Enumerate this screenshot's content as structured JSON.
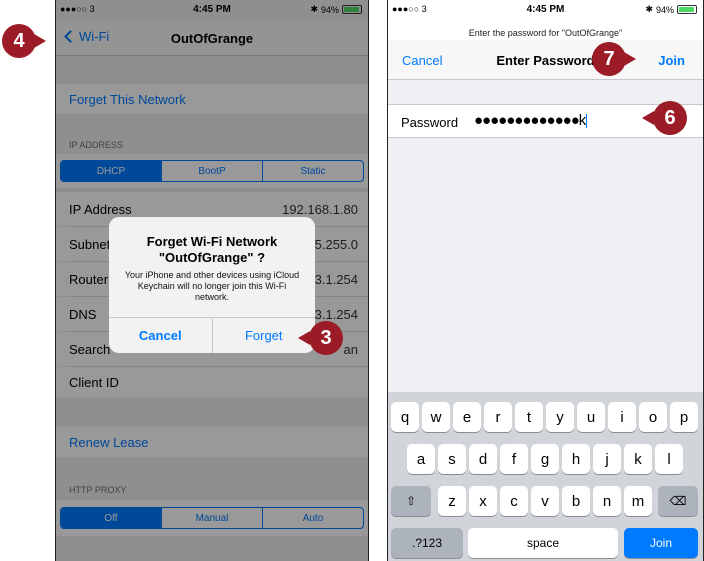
{
  "left": {
    "status": {
      "carrier": "●●●○○ 3",
      "time": "4:45 PM",
      "battery": "94%"
    },
    "nav": {
      "back_label": "Wi-Fi",
      "title": "OutOfGrange"
    },
    "forget_network": "Forget This Network",
    "ip_header": "IP ADDRESS",
    "ip_modes": [
      "DHCP",
      "BootP",
      "Static"
    ],
    "rows": [
      {
        "label": "IP Address",
        "value": "192.168.1.80"
      },
      {
        "label": "Subnet",
        "value": "5.255.0"
      },
      {
        "label": "Router",
        "value": "3.1.254"
      },
      {
        "label": "DNS",
        "value": "3.1.254"
      },
      {
        "label": "Search",
        "value": "an"
      },
      {
        "label": "Client ID",
        "value": ""
      }
    ],
    "renew_lease": "Renew Lease",
    "proxy_header": "HTTP PROXY",
    "proxy_modes": [
      "Off",
      "Manual",
      "Auto"
    ],
    "alert": {
      "title": "Forget Wi-Fi Network \"OutOfGrange\" ?",
      "message": "Your iPhone and other devices using iCloud Keychain will no longer join this Wi-Fi network.",
      "cancel": "Cancel",
      "forget": "Forget"
    }
  },
  "right": {
    "status": {
      "carrier": "●●●○○ 3",
      "time": "4:45 PM",
      "battery": "94%"
    },
    "prompt": "Enter the password for \"OutOfGrange\"",
    "nav": {
      "cancel": "Cancel",
      "title": "Enter Password",
      "join": "Join"
    },
    "password_label": "Password",
    "password_value": "●●●●●●●●●●●●●k",
    "keyboard": {
      "row1": [
        "q",
        "w",
        "e",
        "r",
        "t",
        "y",
        "u",
        "i",
        "o",
        "p"
      ],
      "row2": [
        "a",
        "s",
        "d",
        "f",
        "g",
        "h",
        "j",
        "k",
        "l"
      ],
      "row3": [
        "z",
        "x",
        "c",
        "v",
        "b",
        "n",
        "m"
      ],
      "numbers_key": ".?123",
      "space_key": "space",
      "join_key": "Join"
    }
  },
  "callouts": {
    "c3": "3",
    "c4": "4",
    "c6": "6",
    "c7": "7"
  },
  "colors": {
    "accent": "#007aff",
    "callout": "#9b1b27"
  }
}
